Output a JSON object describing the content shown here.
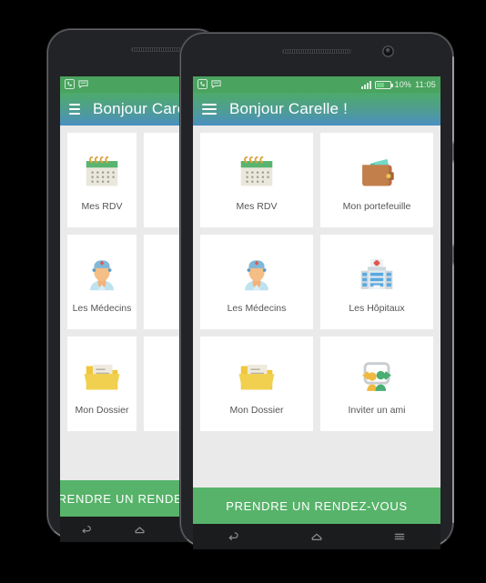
{
  "device": {
    "speaker_icon": "speaker-grille",
    "camera_icon": "front-camera"
  },
  "status_bar": {
    "call_icon": "phone-call-icon",
    "message_icon": "message-bubble-icon",
    "signal_icon": "signal-bars-icon",
    "battery_icon": "battery-icon",
    "battery_level": "10%",
    "time": "11:05"
  },
  "app_bar": {
    "menu_icon": "hamburger-menu-icon",
    "title": "Bonjour Carelle !"
  },
  "grid": {
    "cards": [
      {
        "label": "Mes RDV",
        "icon": "calendar-icon"
      },
      {
        "label": "Mon portefeuille",
        "icon": "wallet-icon"
      },
      {
        "label": "Les Médecins",
        "icon": "doctor-icon"
      },
      {
        "label": "Les Hôpitaux",
        "icon": "hospital-icon"
      },
      {
        "label": "Mon Dossier",
        "icon": "folder-icon"
      },
      {
        "label": "Inviter un ami",
        "icon": "invite-friend-icon"
      }
    ]
  },
  "cta": {
    "label": "PRENDRE UN RENDEZ-VOUS"
  },
  "nav_bar": {
    "back_icon": "back-arrow-icon",
    "home_icon": "home-icon",
    "recents_icon": "recents-icon"
  },
  "colors": {
    "status_bar_green": "#4aa35f",
    "appbar_gradient_start": "#4cab6b",
    "appbar_gradient_end": "#4b90c0",
    "cta_green": "#57b36a",
    "screen_background": "#ebeaea",
    "card_background": "#ffffff",
    "label_text": "#555555"
  }
}
